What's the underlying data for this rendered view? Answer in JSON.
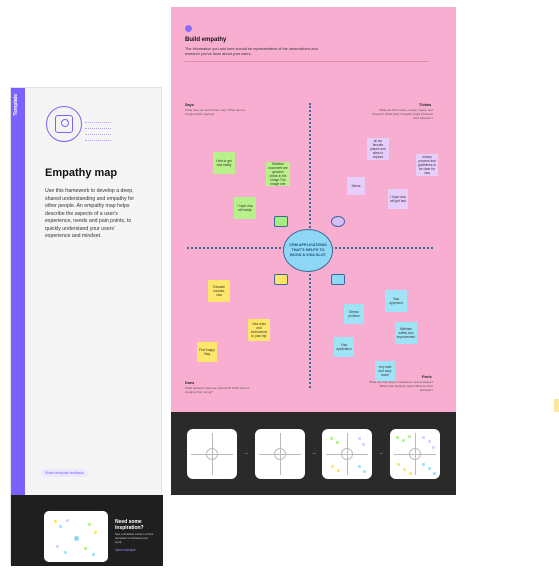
{
  "left_panel": {
    "strip_label": "Template",
    "title": "Empathy map",
    "description": "Use this framework to develop a deep, shared understanding and empathy for other people. An empathy map helps describe the aspects of a user's experience, needs and pain points, to quickly understand your users' experience and mindset.",
    "feedback_label": "Share template feedback",
    "footer": {
      "title": "Need some inspiration?",
      "text": "See a finished version of this template to kickstart your work",
      "button": "Open example"
    }
  },
  "canvas": {
    "title": "Build empathy",
    "description": "The information you add here should be representative of the observations and research you've done about your users.",
    "center_text": "CRM APPLICATIONS THAT'S HELPS TO BOOK A VISA SLOT",
    "quadrants": {
      "says": {
        "label": "Says",
        "sub": "What have we heard them say? What can we imagine them saying?"
      },
      "thinks": {
        "label": "Thinks",
        "sub": "What are their wants, needs, hopes, and dreams? What other thoughts might influence their behavior?"
      },
      "does": {
        "label": "Does",
        "sub": "What behavior have we observed? What can we imagine them doing?"
      },
      "feels": {
        "label": "Feels",
        "sub": "What are their fears, frustrations, and anxieties? What other feelings might influence their behavior?"
      }
    },
    "stickies": {
      "green_1": "How to get visa easily",
      "green_2": "Whether document are genuine check in the image The image one",
      "green_3": "I hope visa will easily",
      "purple_1": "all our favorite places and sites to explore",
      "purple_2": "money process and guidelines to be clear for visa",
      "purple_3": "Stress",
      "purple_4": "I hope visa will get fast",
      "yellow_1": "Educate courses, visa",
      "yellow_2": "Visa rules and instructions to plan trip",
      "yellow_3": "Feel happy Stay",
      "blue_1": "Visa approved",
      "blue_2": "Stress/ problem",
      "blue_3": "Maintain safety and improvement",
      "blue_4": "Visa application",
      "blue_5": "very safe and easy travel"
    }
  },
  "icons": {
    "hero": "profile-card-icon",
    "badge": "step-badge-icon",
    "says": "speech-bubble-icon",
    "thinks": "thought-bubble-icon",
    "does": "hand-icon",
    "feels": "heart-icon",
    "arrow": "arrow-right-icon"
  },
  "colors": {
    "accent": "#7b61ff",
    "canvas_pink": "#f7aed0",
    "sticky_green": "#b8f08a",
    "sticky_yellow": "#fde66a",
    "sticky_purple": "#e6cdfa",
    "sticky_blue": "#9fe3f6",
    "center_blue": "#8fd8f5",
    "dark": "#2a2a2a"
  }
}
